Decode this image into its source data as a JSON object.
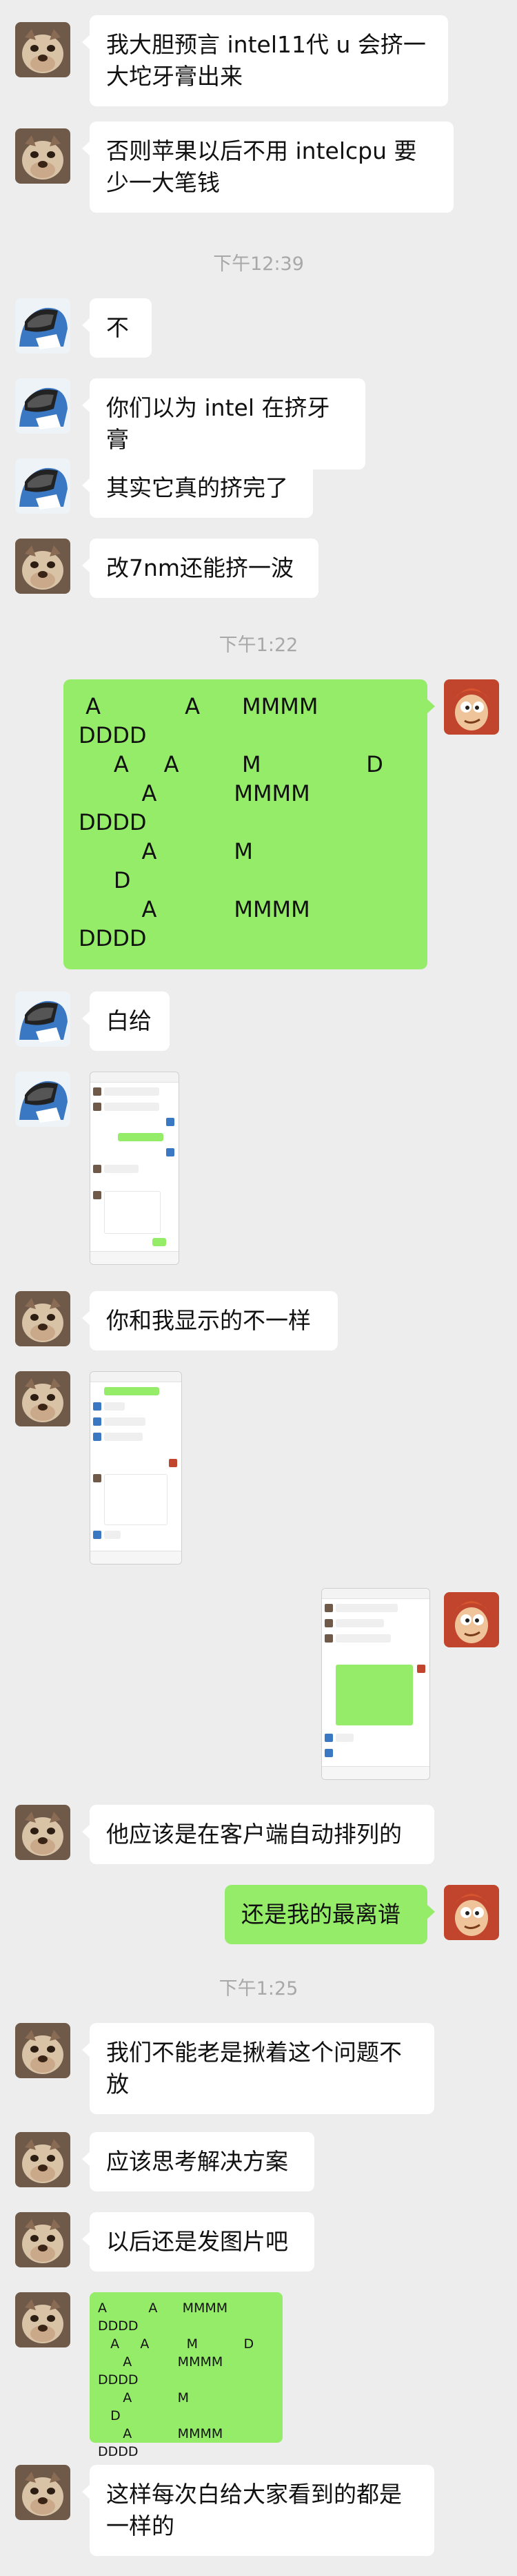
{
  "messages": {
    "m1": "我大胆预言 intel11代 u 会挤一大坨牙膏出来",
    "m2": "否则苹果以后不用 intelcpu 要少一大笔钱",
    "t1": "下午12:39",
    "m3": "不",
    "m4": "你们以为 intel 在挤牙膏",
    "m5": "其实它真的挤完了",
    "m6": "改7nm还能挤一波",
    "t2": "下午1:22",
    "m7": " A            A      MMMM\nDDDD\n     A     A         M               D\n         A           MMMM\nDDDD\n         A           M\n     D\n         A           MMMM\nDDDD",
    "m8": "白给",
    "m9": "你和我显示的不一样",
    "m10": "他应该是在客户端自动排列的",
    "m11": "还是我的最离谱",
    "t3": "下午1:25",
    "m12": "我们不能老是揪着这个问题不放",
    "m13": "应该思考解决方案",
    "m14": "以后还是发图片吧",
    "m15": "A          A      MMMM\nDDDD\n   A     A         M           D\n      A           MMMM\nDDDD\n      A           M\n   D\n      A           MMMM\nDDDD",
    "m16": "这样每次白给大家看到的都是一样的"
  },
  "colors": {
    "background": "#ededed",
    "bubble_self": "#95ec69",
    "bubble_other": "#ffffff",
    "timestamp": "#a8a8a8"
  },
  "icons": {
    "avatar_a": "bulldog-avatar",
    "avatar_b": "helmet-avatar",
    "avatar_self": "cartoon-avatar"
  }
}
